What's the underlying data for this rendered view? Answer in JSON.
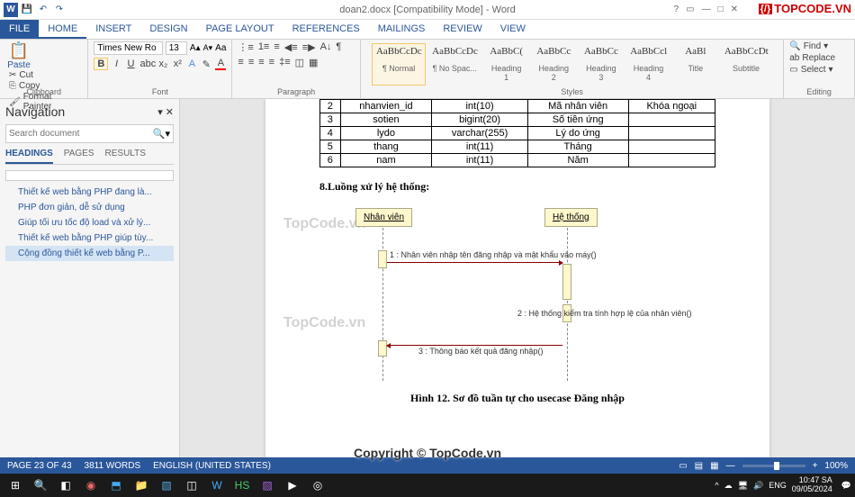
{
  "titlebar": {
    "title": "doan2.docx [Compatibility Mode] - Word"
  },
  "logo": {
    "text": "TOPCODE.VN"
  },
  "tabs": {
    "file": "FILE",
    "home": "HOME",
    "insert": "INSERT",
    "design": "DESIGN",
    "pagelayout": "PAGE LAYOUT",
    "references": "REFERENCES",
    "mailings": "MAILINGS",
    "review": "REVIEW",
    "view": "VIEW"
  },
  "ribbon": {
    "clipboard": {
      "paste": "Paste",
      "cut": "Cut",
      "copy": "Copy",
      "fp": "Format Painter",
      "label": "Clipboard"
    },
    "font": {
      "name": "Times New Ro",
      "size": "13",
      "label": "Font"
    },
    "para": {
      "label": "Paragraph"
    },
    "styles": {
      "label": "Styles",
      "items": [
        {
          "prev": "AaBbCcDc",
          "nm": "¶ Normal"
        },
        {
          "prev": "AaBbCcDc",
          "nm": "¶ No Spac..."
        },
        {
          "prev": "AaBbC(",
          "nm": "Heading 1"
        },
        {
          "prev": "AaBbCc",
          "nm": "Heading 2"
        },
        {
          "prev": "AaBbCc",
          "nm": "Heading 3"
        },
        {
          "prev": "AaBbCcl",
          "nm": "Heading 4"
        },
        {
          "prev": "AaBl",
          "nm": "Title"
        },
        {
          "prev": "AaBbCcDt",
          "nm": "Subtitle"
        }
      ]
    },
    "editing": {
      "find": "Find",
      "replace": "Replace",
      "select": "Select",
      "label": "Editing"
    }
  },
  "nav": {
    "title": "Navigation",
    "searchPlaceholder": "Search document",
    "tabs": {
      "headings": "HEADINGS",
      "pages": "PAGES",
      "results": "RESULTS"
    },
    "items": [
      "Thiết kế web bằng PHP đang là...",
      "PHP đơn giản, dễ sử dụng",
      "Giúp tối ưu tốc độ load và xử lý...",
      "Thiết kế web bằng PHP giúp tùy...",
      "Cộng đồng thiết kế web bằng P..."
    ]
  },
  "table": {
    "rows": [
      [
        "2",
        "nhanvien_id",
        "int(10)",
        "Mã nhân viên",
        "Khóa ngoại"
      ],
      [
        "3",
        "sotien",
        "bigint(20)",
        "Số tiền ứng",
        ""
      ],
      [
        "4",
        "lydo",
        "varchar(255)",
        "Lý do ứng",
        ""
      ],
      [
        "5",
        "thang",
        "int(11)",
        "Tháng",
        ""
      ],
      [
        "6",
        "nam",
        "int(11)",
        "Năm",
        ""
      ]
    ]
  },
  "section": "8.Luồng xử lý hệ thống:",
  "diagram": {
    "actor1": "Nhân viên",
    "actor2": "Hệ thống",
    "msg1": "1 : Nhân viên nhập tên đăng nhập và mật khẩu vào máy()",
    "msg2": "2 : Hệ thống kiểm tra tính hợp lệ của nhân viên()",
    "msg3": "3 : Thông báo kết quả đăng nhập()"
  },
  "caption": "Hình 12. Sơ đồ tuần tự cho usecase Đăng nhập",
  "watermark": "TopCode.vn",
  "status": {
    "page": "PAGE 23 OF 43",
    "words": "3811 WORDS",
    "lang": "ENGLISH (UNITED STATES)",
    "zoom": "100%"
  },
  "taskbar": {
    "lang": "ENG",
    "time": "10:47 SA",
    "date": "09/05/2024"
  },
  "copyright": "Copyright © TopCode.vn"
}
